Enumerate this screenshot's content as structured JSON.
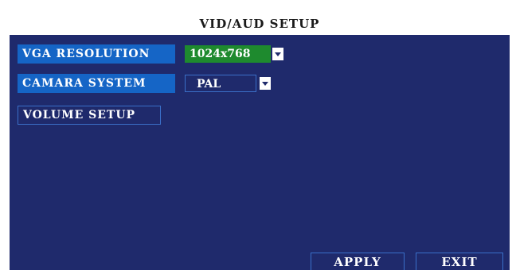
{
  "window": {
    "title": "VID/AUD SETUP"
  },
  "settings": {
    "vga_resolution": {
      "label": "VGA RESOLUTION",
      "value": "1024x768"
    },
    "camera_system": {
      "label": "CAMARA SYSTEM",
      "value": "PAL"
    },
    "volume_setup": {
      "label": "VOLUME SETUP"
    }
  },
  "buttons": {
    "apply": "APPLY",
    "exit": "EXIT"
  },
  "icons": {
    "dropdown": "chevron-down-icon"
  },
  "colors": {
    "panel_background": "#1f2a6c",
    "label_highlight": "#1565c6",
    "selected_value": "#1e8a2e",
    "outline": "#3a6fc8"
  }
}
